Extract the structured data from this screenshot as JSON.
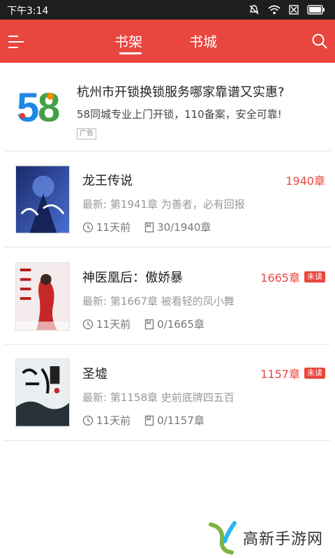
{
  "status_bar": {
    "time": "下午3:14",
    "icons": [
      "mute-icon",
      "wifi-icon",
      "sim-icon",
      "battery-icon"
    ]
  },
  "header": {
    "menu_icon": "menu-icon",
    "tabs": [
      {
        "label": "书架",
        "active": true
      },
      {
        "label": "书城",
        "active": false
      }
    ],
    "search_icon": "search-icon",
    "bg_color": "#e8463f"
  },
  "ad": {
    "logo_text": "58",
    "title": "杭州市开锁换锁服务哪家靠谱又实惠?",
    "desc": "58同城专业上门开锁，110备案，安全可靠!",
    "badge": "广告"
  },
  "books": [
    {
      "title": "龙王传说",
      "chapters": "1940章",
      "unread": false,
      "latest": "最新: 第1941章 为善者，必有回报",
      "updated": "11天前",
      "progress": "30/1940章"
    },
    {
      "title": "神医凰后：傲娇暴",
      "chapters": "1665章",
      "unread": true,
      "unread_label": "未读",
      "latest": "最新: 第1667章 被看轻的凤小舞",
      "updated": "11天前",
      "progress": "0/1665章"
    },
    {
      "title": "圣墟",
      "chapters": "1157章",
      "unread": true,
      "unread_label": "未读",
      "latest": "最新: 第1158章 史前底牌四五百",
      "updated": "11天前",
      "progress": "0/1157章"
    }
  ],
  "watermark": {
    "text": "高新手游网"
  }
}
